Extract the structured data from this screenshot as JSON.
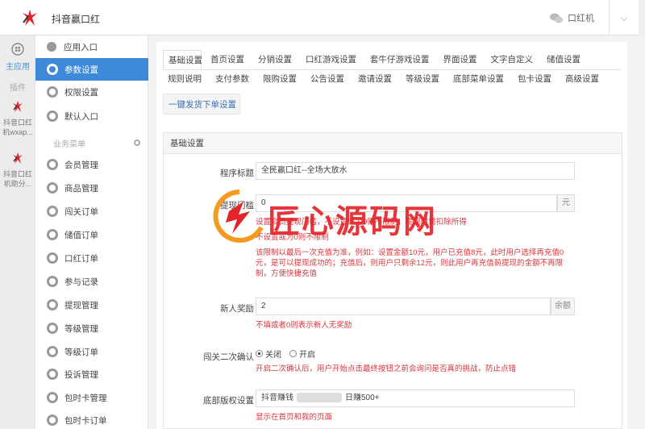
{
  "topbar": {
    "app_title": "抖音赢口红",
    "user": "口红机",
    "chevron": "⌵"
  },
  "rail": {
    "home_label": "主应用",
    "section_label": "插件",
    "apps": [
      {
        "name": "抖音口红机wxap..."
      },
      {
        "name": "抖音口红机助分..."
      }
    ]
  },
  "sidebar": {
    "items_top": [
      {
        "label": "应用入口"
      },
      {
        "label": "参数设置"
      },
      {
        "label": "权限设置"
      },
      {
        "label": "默认入口"
      }
    ],
    "group_label": "业务菜单",
    "items_group": [
      {
        "label": "会员管理"
      },
      {
        "label": "商品管理"
      },
      {
        "label": "闯关订单"
      },
      {
        "label": "储值订单"
      },
      {
        "label": "口红订单"
      },
      {
        "label": "参与记录"
      },
      {
        "label": "提现管理"
      },
      {
        "label": "等级管理"
      },
      {
        "label": "等级订单"
      },
      {
        "label": "投诉管理"
      },
      {
        "label": "包时卡管理"
      },
      {
        "label": "包时卡订单"
      }
    ]
  },
  "tabs": {
    "row1": [
      "基础设置",
      "首页设置",
      "分销设置",
      "口红游戏设置",
      "套牛仔游戏设置",
      "界面设置",
      "文字自定义",
      "储值设置"
    ],
    "row2": [
      "规则说明",
      "支付参数",
      "限购设置",
      "公告设置",
      "邀请设置",
      "等级设置",
      "底部菜单设置",
      "包卡设置",
      "高级设置"
    ],
    "row3": [
      "一键发货下单设置"
    ]
  },
  "panel": {
    "title": "基础设置",
    "fields": {
      "program_title_label": "程序标题",
      "program_title_value": "全民赢口红--全场大放水",
      "withdraw_label": "提现门槛",
      "withdraw_value": "0",
      "withdraw_unit": "元",
      "withdraw_hint1": "设置会员提现门槛，不设置或为0则不限制，提现时需扣除所得",
      "withdraw_hint2": "不设置或为0则不限制",
      "withdraw_hint3": "该限制以最后一次充值为准，例如：设置金额10元，用户已充值8元，此时用户选择再充值0元，是可以提现成功的；充值后，则用户只剩余12元，则此用户再充值前提现的金额不再限制，方便快捷充值",
      "new_reward_label": "新人奖励",
      "new_reward_value": "2",
      "new_reward_unit": "余额",
      "new_reward_hint": "不填或者0则表示新人无奖励",
      "confirm_label": "闯关二次确认",
      "confirm_off": "关闭",
      "confirm_on": "开启",
      "confirm_hint": "开启二次确认后，用户开始点击最终按钮之前会询问是否真的挑战，防止点错",
      "bottom_label": "底部版权设置",
      "bottom_value_a": "抖音赚钱",
      "bottom_value_b": "日赚500+",
      "bottom_hint": "显示在首页和我的页面"
    }
  },
  "watermark": {
    "text": "匠心源码网"
  },
  "colors": {
    "accent": "#3e8ad8",
    "hint": "#d9363e",
    "watermark": "#e4242b"
  }
}
